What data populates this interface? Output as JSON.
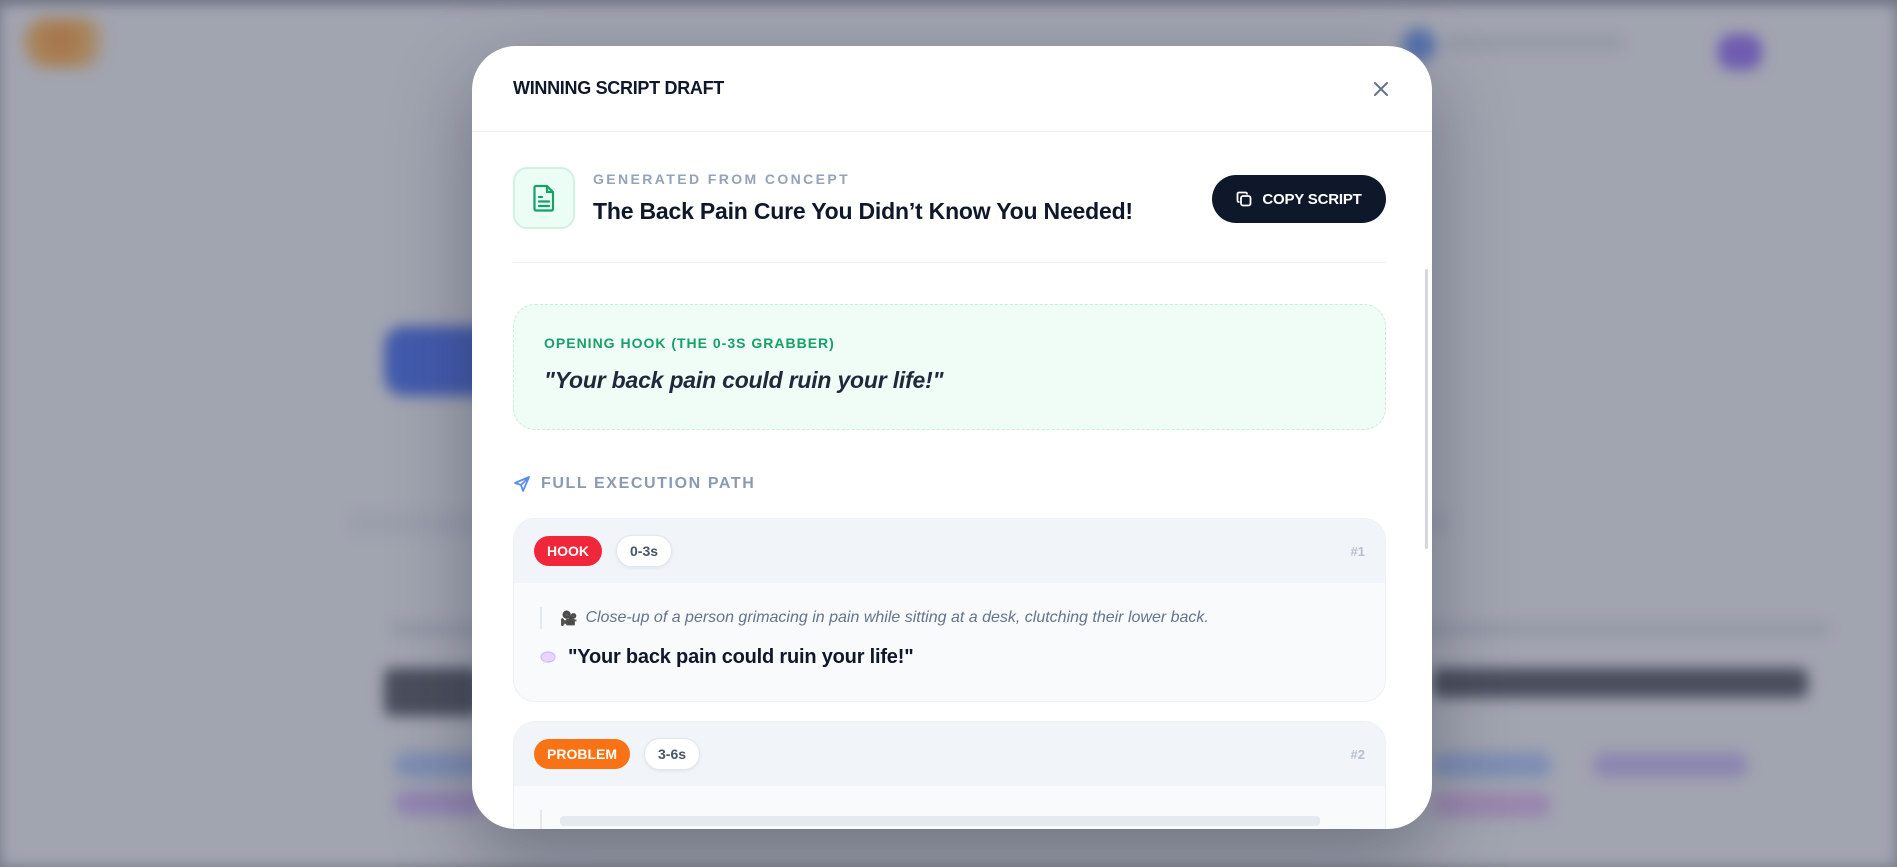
{
  "modal": {
    "title": "WINNING SCRIPT DRAFT",
    "concept_kicker": "GENERATED FROM CONCEPT",
    "concept_title": "The Back Pain Cure You Didn’t Know You Needed!",
    "copy_label": "COPY SCRIPT",
    "hook_label": "OPENING HOOK (THE 0-3S GRABBER)",
    "hook_quote": "\"Your back pain could ruin your life!\"",
    "path_label": "FULL EXECUTION PATH"
  },
  "steps": [
    {
      "badge": "HOOK",
      "badge_color": "#f0263a",
      "time": "0-3s",
      "num": "#1",
      "visual": "Close-up of a person grimacing in pain while sitting at a desk, clutching their lower back.",
      "voiceover": "\"Your back pain could ruin your life!\""
    },
    {
      "badge": "PROBLEM",
      "badge_color": "#f97316",
      "time": "3-6s",
      "num": "#2"
    }
  ],
  "colors": {
    "accent_green": "#16a06a",
    "dark_button": "#0f172a",
    "overlay": "#565c70"
  },
  "icons": {
    "close": "close-icon",
    "document": "document-icon",
    "copy": "copy-icon",
    "send": "send-icon",
    "visual": "film-camera-icon",
    "voiceover": "speech-bubble-icon"
  }
}
